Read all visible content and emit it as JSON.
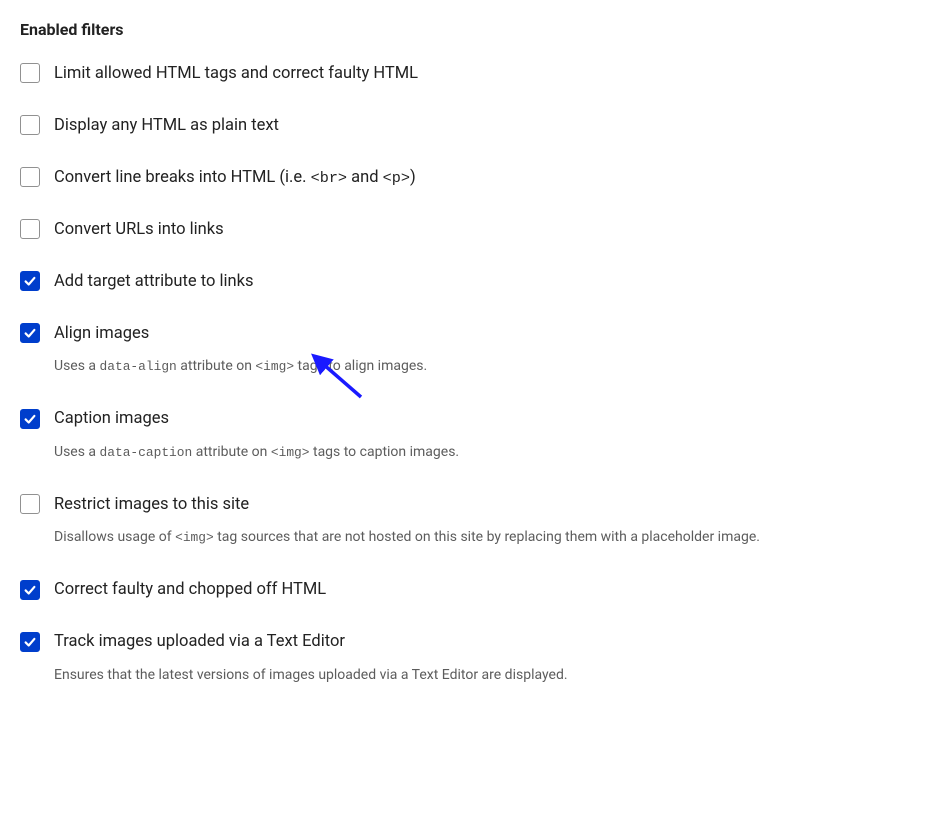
{
  "section": {
    "title": "Enabled filters"
  },
  "filters": [
    {
      "checked": false,
      "label_html": "Limit allowed HTML tags and correct faulty HTML",
      "desc_html": null
    },
    {
      "checked": false,
      "label_html": "Display any HTML as plain text",
      "desc_html": null
    },
    {
      "checked": false,
      "label_html": "Convert line breaks into HTML (i.e. <code>&lt;br&gt;</code> and <code>&lt;p&gt;</code>)",
      "desc_html": null
    },
    {
      "checked": false,
      "label_html": "Convert URLs into links",
      "desc_html": null
    },
    {
      "checked": true,
      "label_html": "Add target attribute to links",
      "desc_html": null
    },
    {
      "checked": true,
      "label_html": "Align images",
      "desc_html": "Uses a <code>data-align</code> attribute on <code>&lt;img&gt;</code> tags to align images."
    },
    {
      "checked": true,
      "label_html": "Caption images",
      "desc_html": "Uses a <code>data-caption</code> attribute on <code>&lt;img&gt;</code> tags to caption images."
    },
    {
      "checked": false,
      "label_html": "Restrict images to this site",
      "desc_html": "Disallows usage of <code>&lt;img&gt;</code> tag sources that are not hosted on this site by replacing them with a placeholder image."
    },
    {
      "checked": true,
      "label_html": "Correct faulty and chopped off HTML",
      "desc_html": null
    },
    {
      "checked": true,
      "label_html": "Track images uploaded via a Text Editor",
      "desc_html": "Ensures that the latest versions of images uploaded via a Text Editor are displayed."
    }
  ],
  "annotation": {
    "arrow_color": "#1a1aff"
  }
}
